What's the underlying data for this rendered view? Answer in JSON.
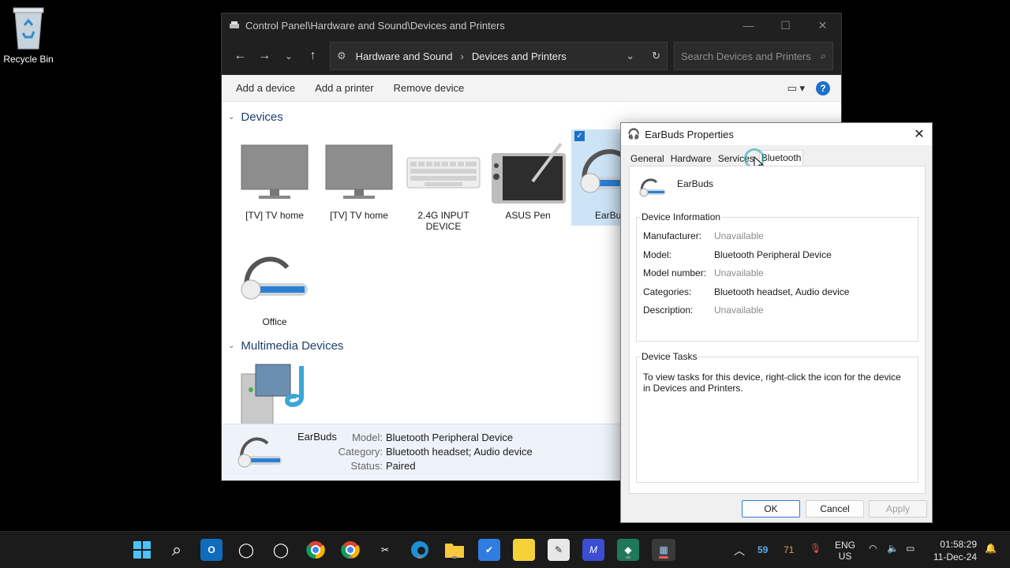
{
  "desktop": {
    "recycle_bin_label": "Recycle Bin"
  },
  "explorer": {
    "title": "Control Panel\\Hardware and Sound\\Devices and Printers",
    "breadcrumb": [
      "Hardware and Sound",
      "Devices and Printers"
    ],
    "search_placeholder": "Search Devices and Printers",
    "commands": [
      "Add a device",
      "Add a printer",
      "Remove device"
    ],
    "help_label": "?",
    "groups": {
      "devices": "Devices",
      "multimedia": "Multimedia Devices"
    },
    "devices": [
      {
        "label": "[TV] TV home",
        "icon": "monitor-icon"
      },
      {
        "label": "[TV] TV home",
        "icon": "monitor-icon"
      },
      {
        "label": "2.4G INPUT DEVICE",
        "icon": "keyboard-icon"
      },
      {
        "label": "ASUS Pen",
        "icon": "pen-tablet-icon"
      },
      {
        "label": "EarBu",
        "icon": "headset-icon",
        "selected": true
      },
      {
        "label": "Office",
        "icon": "headset-icon"
      }
    ],
    "details": {
      "name": "EarBuds",
      "model_key": "Model:",
      "model": "Bluetooth Peripheral Device",
      "category_key": "Category:",
      "category": "Bluetooth headset; Audio device",
      "status_key": "Status:",
      "status": "Paired"
    }
  },
  "dialog": {
    "title": "EarBuds Properties",
    "tabs": [
      "General",
      "Hardware",
      "Services",
      "Bluetooth"
    ],
    "active_tab": "Bluetooth",
    "device_name": "EarBuds",
    "info_legend": "Device Information",
    "info": [
      {
        "key": "Manufacturer:",
        "value": "Unavailable",
        "muted": true
      },
      {
        "key": "Model:",
        "value": "Bluetooth Peripheral Device",
        "muted": false
      },
      {
        "key": "Model number:",
        "value": "Unavailable",
        "muted": true
      },
      {
        "key": "Categories:",
        "value": "Bluetooth headset, Audio device",
        "muted": false
      },
      {
        "key": "Description:",
        "value": "Unavailable",
        "muted": true
      }
    ],
    "tasks_legend": "Device Tasks",
    "tasks_text": "To view tasks for this device, right-click the icon for the device in Devices and Printers.",
    "buttons": {
      "ok": "OK",
      "cancel": "Cancel",
      "apply": "Apply"
    }
  },
  "taskbar": {
    "temp_a": "59",
    "temp_b": "71",
    "lang_1": "ENG",
    "lang_2": "US",
    "time": "01:58:29",
    "date": "11-Dec-24"
  }
}
